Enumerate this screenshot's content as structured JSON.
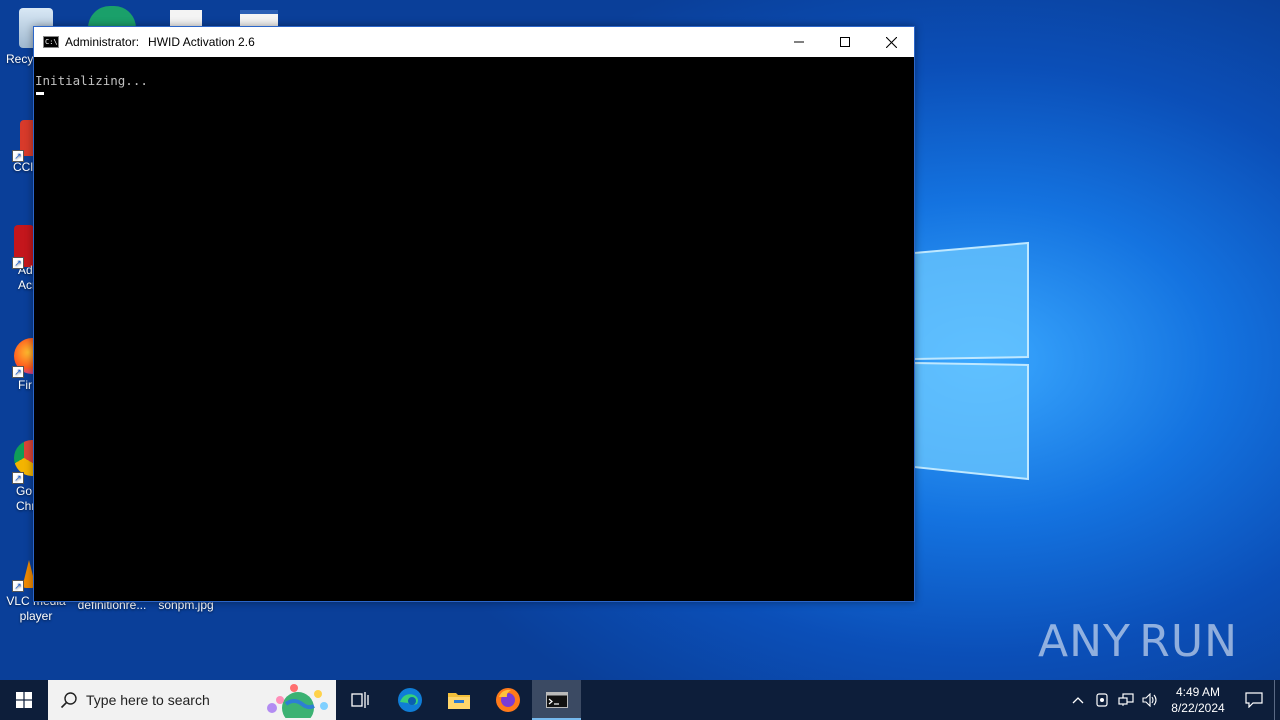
{
  "desktop": {
    "icons": [
      {
        "label": "Recy",
        "icon": "recycle-bin-icon"
      },
      {
        "label": "CCl",
        "icon": "ccleaner-icon"
      },
      {
        "label": "Ad\nAcr",
        "icon": "acrobat-icon"
      },
      {
        "label": "Fir",
        "icon": "firefox-icon"
      },
      {
        "label": "Go\nChr",
        "icon": "chrome-icon"
      },
      {
        "label": "VLC media player",
        "icon": "vlc-icon"
      },
      {
        "label": "definitionre...",
        "icon": "file-icon"
      },
      {
        "label": "sonpm.jpg",
        "icon": "image-file-icon"
      }
    ]
  },
  "window": {
    "title_prefix": "Administrator:",
    "title": "HWID Activation 2.6",
    "console_text": "Initializing...",
    "minimize_symbol": "—",
    "maximize_symbol": "☐",
    "close_symbol": "✕"
  },
  "watermark": {
    "left": "ANY",
    "right": "RUN"
  },
  "taskbar": {
    "search_placeholder": "Type here to search",
    "apps": [
      "task-view",
      "edge",
      "file-explorer",
      "firefox",
      "command-prompt"
    ],
    "clock_time": "4:49 AM",
    "clock_date": "8/22/2024",
    "tray_chevron": "^"
  },
  "colors": {
    "taskbar": "#0d1e3a",
    "desktop_accent": "#1473e0",
    "console_bg": "#000000",
    "console_text": "#c0c0c0"
  }
}
